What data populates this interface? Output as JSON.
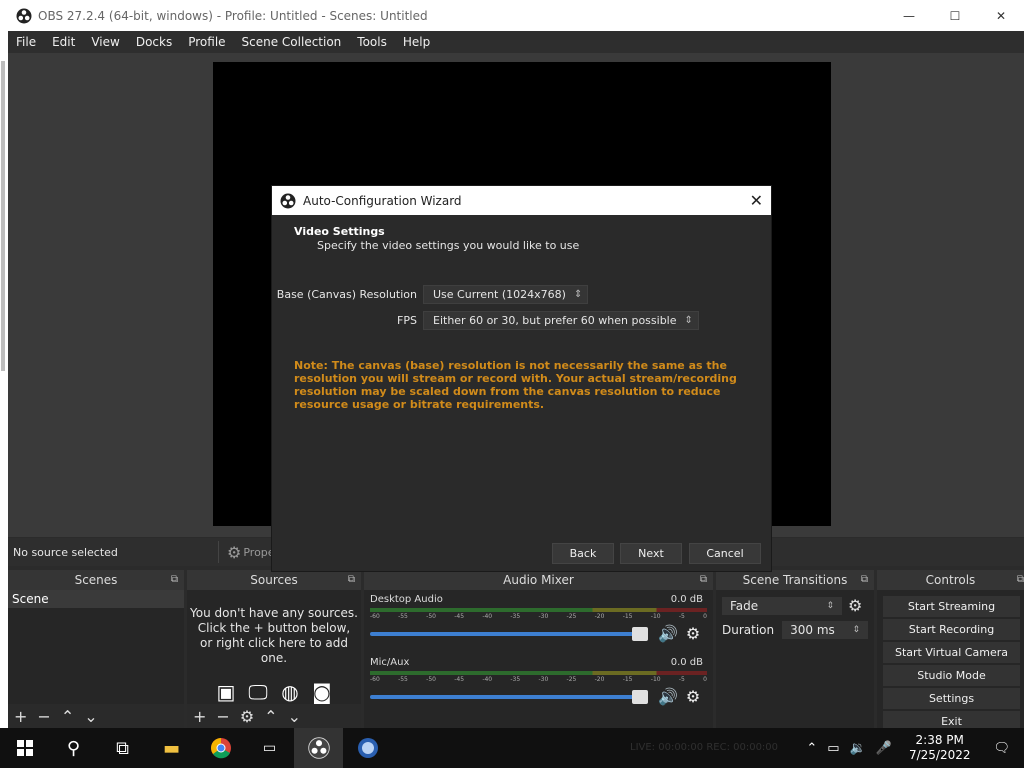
{
  "window": {
    "title": "OBS 27.2.4 (64-bit, windows) - Profile: Untitled - Scenes: Untitled",
    "minimize": "—",
    "maximize": "☐",
    "close": "✕"
  },
  "menu": [
    "File",
    "Edit",
    "View",
    "Docks",
    "Profile",
    "Scene Collection",
    "Tools",
    "Help"
  ],
  "source_bar": {
    "status": "No source selected",
    "properties": "Propert"
  },
  "dialog": {
    "title": "Auto-Configuration Wizard",
    "heading": "Video Settings",
    "subheading": "Specify the video settings you would like to use",
    "resolution_label": "Base (Canvas) Resolution",
    "resolution_value": "Use Current (1024x768)",
    "fps_label": "FPS",
    "fps_value": "Either 60 or 30, but prefer 60 when possible",
    "note": "Note: The canvas (base) resolution is not necessarily the same as the resolution you will stream or record with. Your actual stream/recording resolution may be scaled down from the canvas resolution to reduce resource usage or bitrate requirements.",
    "back": "Back",
    "next": "Next",
    "cancel": "Cancel",
    "close": "✕"
  },
  "docks": {
    "scenes": {
      "title": "Scenes",
      "items": [
        "Scene"
      ]
    },
    "sources": {
      "title": "Sources",
      "empty_1": "You don't have any sources.",
      "empty_2": "Click the + button below,",
      "empty_3": "or right click here to add one."
    },
    "mixer": {
      "title": "Audio Mixer",
      "tracks": [
        {
          "name": "Desktop Audio",
          "db": "0.0 dB"
        },
        {
          "name": "Mic/Aux",
          "db": "0.0 dB"
        }
      ],
      "ticks": [
        "-60",
        "-55",
        "-50",
        "-45",
        "-40",
        "-35",
        "-30",
        "-25",
        "-20",
        "-15",
        "-10",
        "-5",
        "0"
      ]
    },
    "transitions": {
      "title": "Scene Transitions",
      "value": "Fade",
      "duration_label": "Duration",
      "duration_value": "300 ms"
    },
    "controls": {
      "title": "Controls",
      "buttons": [
        "Start Streaming",
        "Start Recording",
        "Start Virtual Camera",
        "Studio Mode",
        "Settings",
        "Exit"
      ]
    }
  },
  "taskbar": {
    "status_ghost": "LIVE: 00:00:00   REC: 00:00:00",
    "time": "2:38 PM",
    "date": "7/25/2022"
  },
  "colors": {
    "note": "#d18b1a",
    "slider": "#3d7fd1"
  }
}
